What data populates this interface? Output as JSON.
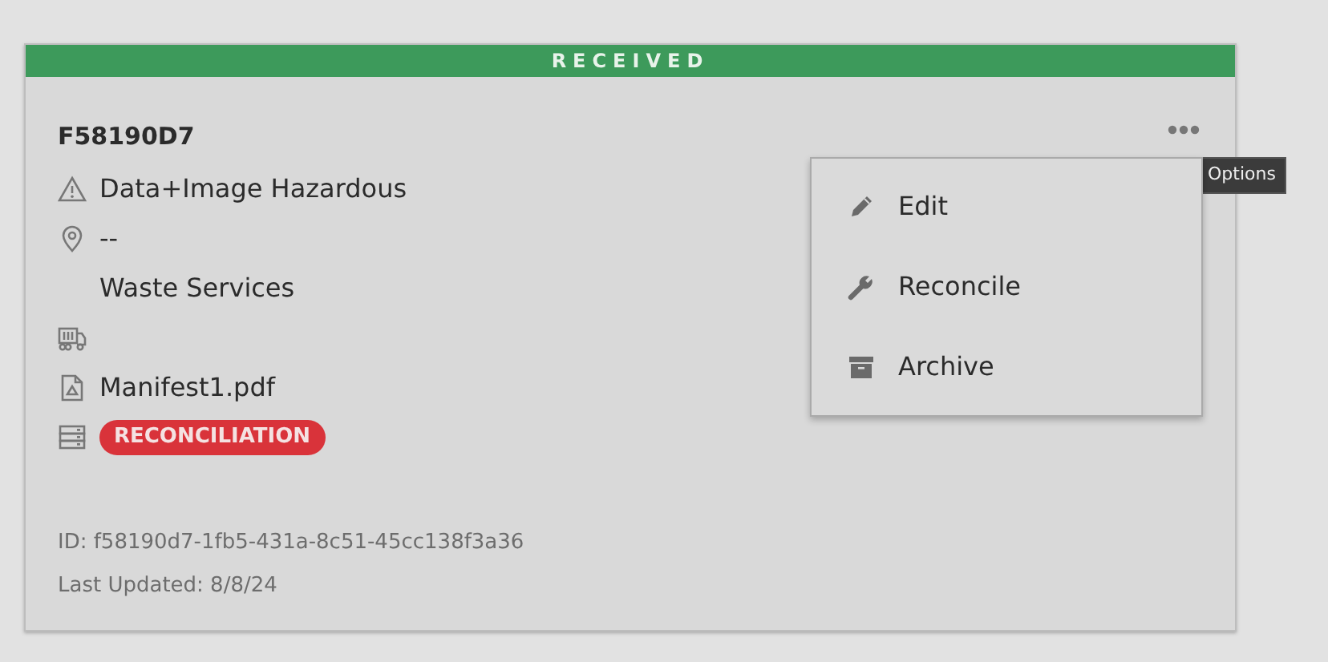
{
  "status_banner": "RECEIVED",
  "record": {
    "code": "F58190D7",
    "waste_type": "Data+Image Hazardous",
    "location": "--",
    "facility": "Waste Services",
    "document": "Manifest1.pdf",
    "badge": "RECONCILIATION"
  },
  "footer": {
    "id": "ID: f58190d7-1fb5-431a-8c51-45cc138f3a36",
    "updated": "Last Updated: 8/8/24"
  },
  "options_tooltip": "Options",
  "menu": [
    {
      "kind": "edit",
      "label": "Edit"
    },
    {
      "kind": "reconcile",
      "label": "Reconcile"
    },
    {
      "kind": "archive",
      "label": "Archive"
    }
  ]
}
